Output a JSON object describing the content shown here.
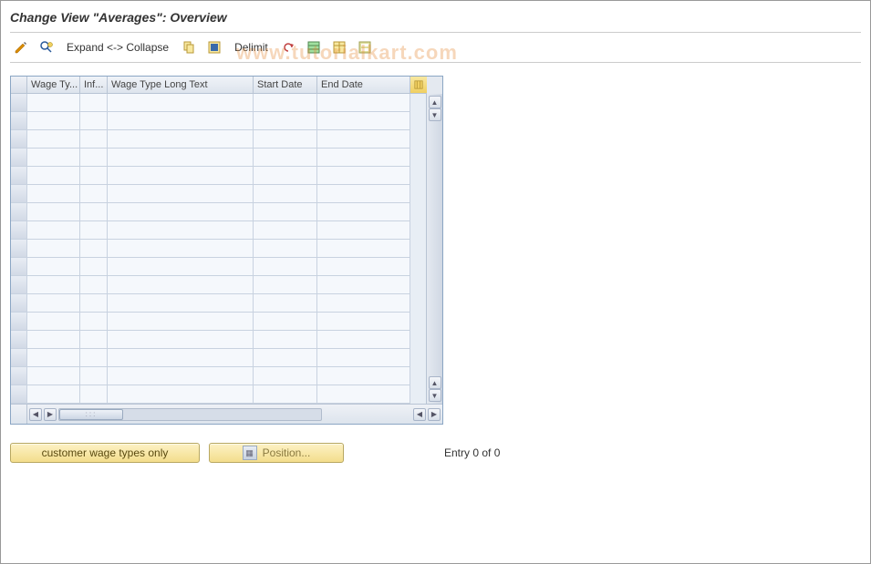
{
  "title": "Change View \"Averages\": Overview",
  "toolbar": {
    "expand_collapse": "Expand <-> Collapse",
    "delimit": "Delimit"
  },
  "watermark": "www.tutorialkart.com",
  "grid": {
    "columns": {
      "wage_type": "Wage Ty...",
      "infotype": "Inf...",
      "wage_long": "Wage Type Long Text",
      "start_date": "Start Date",
      "end_date": "End Date"
    },
    "row_count": 17
  },
  "footer": {
    "customer_btn": "customer wage types only",
    "position_btn": "Position...",
    "entry_text": "Entry 0 of 0"
  }
}
